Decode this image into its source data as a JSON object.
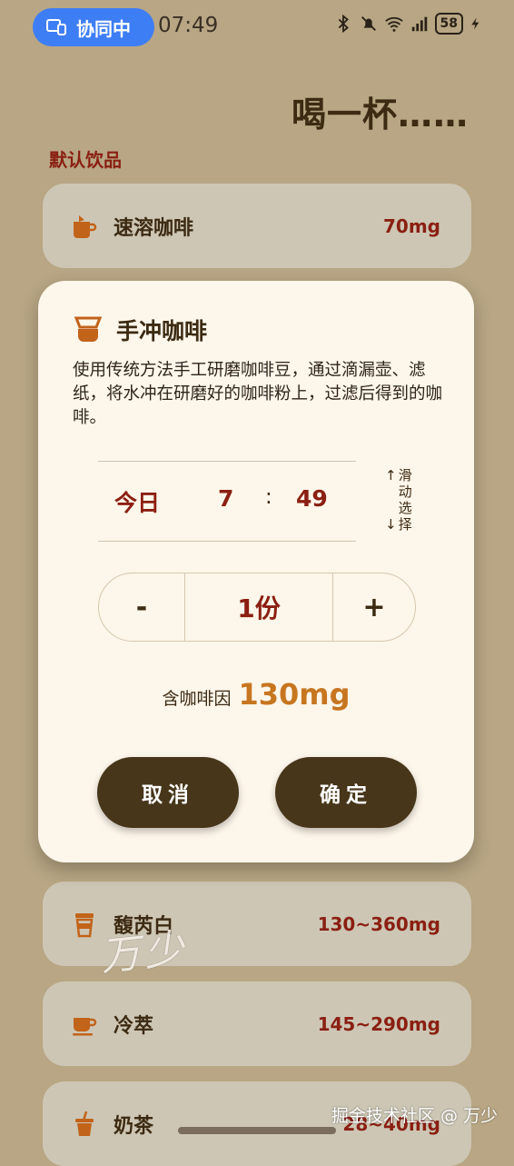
{
  "status_bar": {
    "collab_label": "协同中",
    "time": "07:49",
    "battery": "58"
  },
  "page": {
    "title": "喝一杯……",
    "section_label": "默认饮品"
  },
  "drinks": [
    {
      "name": "速溶咖啡",
      "caffeine": "70mg",
      "icon": "instant-coffee-icon"
    },
    {
      "name": "馥芮白",
      "caffeine": "130~360mg",
      "icon": "takeaway-cup-icon"
    },
    {
      "name": "冷萃",
      "caffeine": "145~290mg",
      "icon": "coffee-cup-icon"
    },
    {
      "name": "奶茶",
      "caffeine": "28~40mg",
      "icon": "milk-tea-icon"
    }
  ],
  "dialog": {
    "title": "手冲咖啡",
    "description": "使用传统方法手工研磨咖啡豆，通过滴漏壶、滤纸，将水冲在研磨好的咖啡粉上，过滤后得到的咖啡。",
    "picker": {
      "day": "今日",
      "hour": "7",
      "separator": ":",
      "minute": "49",
      "hint_up": "↑",
      "hint_down": "↓",
      "hint_text": "滑动选择"
    },
    "stepper": {
      "minus": "-",
      "value": "1份",
      "plus": "+"
    },
    "caffeine_label": "含咖啡因",
    "caffeine_value": "130mg",
    "cancel_label": "取消",
    "confirm_label": "确定"
  },
  "watermarks": {
    "handwritten": "万少",
    "site": "掘金技术社区 @ 万少"
  },
  "colors": {
    "background": "#b8a684",
    "card": "#cdc6b4",
    "dialog": "#fdf6ea",
    "accent_red": "#8a1f12",
    "accent_orange": "#c77620",
    "button": "#48361a",
    "collab_blue": "#3e7ef5"
  }
}
